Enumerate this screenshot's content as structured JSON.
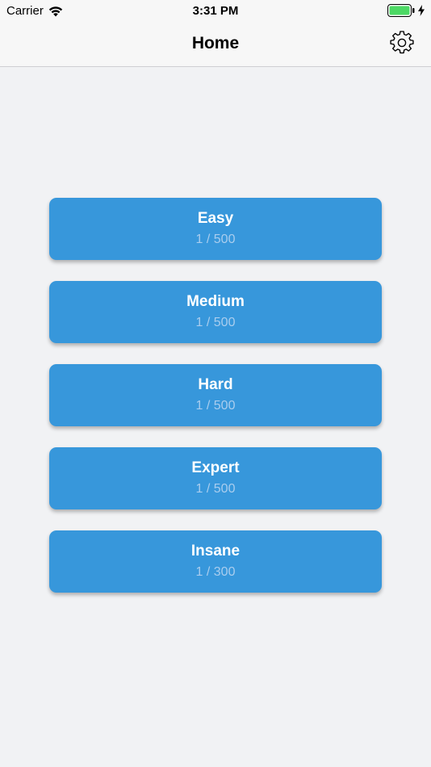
{
  "status_bar": {
    "carrier": "Carrier",
    "time": "3:31 PM",
    "battery_color": "#4cd964"
  },
  "nav": {
    "title": "Home",
    "settings_icon": "gear-icon"
  },
  "levels": [
    {
      "name": "Easy",
      "progress": "1 / 500"
    },
    {
      "name": "Medium",
      "progress": "1 / 500"
    },
    {
      "name": "Hard",
      "progress": "1 / 500"
    },
    {
      "name": "Expert",
      "progress": "1 / 500"
    },
    {
      "name": "Insane",
      "progress": "1 / 300"
    }
  ],
  "colors": {
    "accent": "#3797db",
    "background": "#f1f2f4",
    "progress_text": "#a9cdee"
  }
}
